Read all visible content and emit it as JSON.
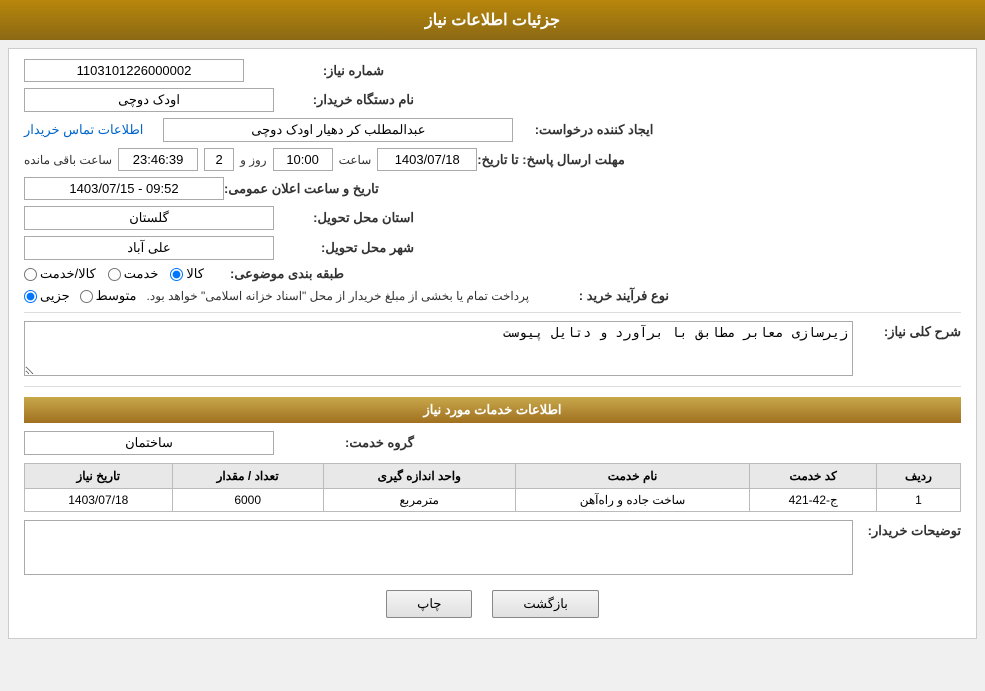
{
  "page": {
    "title": "جزئیات اطلاعات نیاز",
    "services_title": "اطلاعات خدمات مورد نیاز"
  },
  "header": {
    "title": "جزئیات اطلاعات نیاز"
  },
  "fields": {
    "need_number_label": "شماره نیاز:",
    "need_number_value": "1103101226000002",
    "buyer_station_label": "نام دستگاه خریدار:",
    "buyer_station_value": "اودک دوچی",
    "creator_label": "ایجاد کننده درخواست:",
    "creator_value": "عبدالمطلب کر دهیار اودک دوچی",
    "contact_link": "اطلاعات تماس خریدار",
    "deadline_label": "مهلت ارسال پاسخ: تا تاریخ:",
    "deadline_date": "1403/07/18",
    "deadline_time_label": "ساعت",
    "deadline_time": "10:00",
    "deadline_days_label": "روز و",
    "deadline_days": "2",
    "deadline_remain_label": "ساعت باقی مانده",
    "deadline_remain": "23:46:39",
    "announce_label": "تاریخ و ساعت اعلان عمومی:",
    "announce_value": "1403/07/15 - 09:52",
    "province_label": "استان محل تحویل:",
    "province_value": "گلستان",
    "city_label": "شهر محل تحویل:",
    "city_value": "علی آباد",
    "category_label": "طبقه بندی موضوعی:",
    "category_options": [
      {
        "label": "کالا",
        "value": "kala",
        "checked": true
      },
      {
        "label": "خدمت",
        "value": "khedmat",
        "checked": false
      },
      {
        "label": "کالا/خدمت",
        "value": "kala_khedmat",
        "checked": false
      }
    ],
    "process_label": "نوع فرآیند خرید :",
    "process_options": [
      {
        "label": "جزیی",
        "value": "jozii",
        "checked": true
      },
      {
        "label": "متوسط",
        "value": "motavaset",
        "checked": false
      }
    ],
    "process_note": "پرداخت تمام یا بخشی از مبلغ خریدار از محل \"اسناد خزانه اسلامی\" خواهد بود.",
    "general_desc_label": "شرح کلی نیاز:",
    "general_desc_value": "زیرسازی معابر مطابق با برآورد و دتایل پیوست"
  },
  "services": {
    "title": "اطلاعات خدمات مورد نیاز",
    "group_label": "گروه خدمت:",
    "group_value": "ساختمان",
    "table": {
      "headers": [
        "ردیف",
        "کد خدمت",
        "نام خدمت",
        "واحد اندازه گیری",
        "تعداد / مقدار",
        "تاریخ نیاز"
      ],
      "rows": [
        {
          "row_num": "1",
          "code": "ج-42-421",
          "name": "ساخت جاده و راه‌آهن",
          "unit": "مترمربع",
          "quantity": "6000",
          "date": "1403/07/18"
        }
      ]
    },
    "buyer_desc_label": "توضیحات خریدار:",
    "buyer_desc_value": ""
  },
  "buttons": {
    "print_label": "چاپ",
    "back_label": "بازگشت"
  }
}
